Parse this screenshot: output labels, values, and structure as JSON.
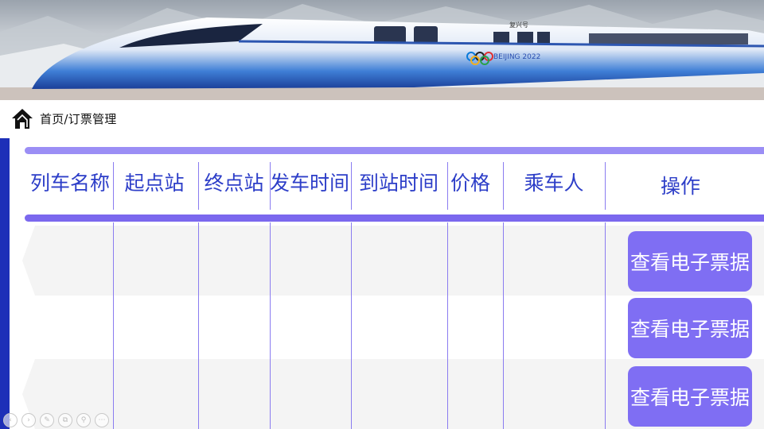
{
  "banner": {
    "train_logo_text": "BEIJING 2022",
    "train_car_text": "复兴号"
  },
  "breadcrumb": {
    "text": "首页/订票管理"
  },
  "table": {
    "columns": [
      "列车名称",
      "起点站",
      "终点站",
      "发车时间",
      "到站时间",
      "价格",
      "乘车人",
      "操作"
    ],
    "rows": [
      {
        "cells": [
          "",
          "",
          "",
          "",
          "",
          "",
          ""
        ],
        "action_label": "查看电子票据"
      },
      {
        "cells": [
          "",
          "",
          "",
          "",
          "",
          "",
          ""
        ],
        "action_label": "查看电子票据"
      },
      {
        "cells": [
          "",
          "",
          "",
          "",
          "",
          "",
          ""
        ],
        "action_label": "查看电子票据"
      }
    ]
  },
  "slide_controls": [
    "prev-icon",
    "next-icon",
    "pen-icon",
    "copy-icon",
    "zoom-icon",
    "more-icon"
  ],
  "colors": {
    "accent": "#7f6ef3",
    "header_text": "#2d3ec8",
    "side_bar": "#1d2fb8"
  }
}
